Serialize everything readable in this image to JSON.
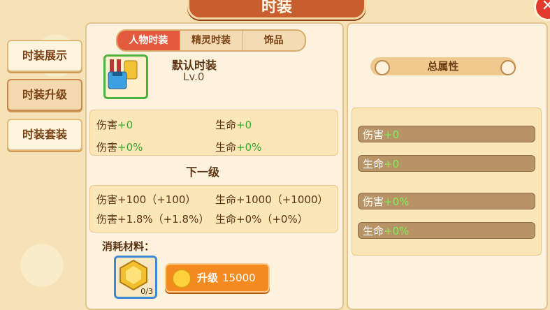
{
  "window": {
    "title": "时装",
    "close_glyph": "✕"
  },
  "sidebar": {
    "items": [
      {
        "label": "时装展示"
      },
      {
        "label": "时装升级",
        "active": true
      },
      {
        "label": "时装套装"
      }
    ]
  },
  "tabs": [
    {
      "label": "人物时装",
      "active": true
    },
    {
      "label": "精灵时装"
    },
    {
      "label": "饰品"
    }
  ],
  "item": {
    "name": "默认时装",
    "level": "Lv.0"
  },
  "current": {
    "damage": {
      "label": "伤害",
      "value": "+0"
    },
    "hp": {
      "label": "生命",
      "value": "+0"
    },
    "damage_pct": {
      "label": "伤害",
      "value": "+0%"
    },
    "hp_pct": {
      "label": "生命",
      "value": "+0%"
    }
  },
  "next": {
    "title": "下一级",
    "row1_left": "伤害+100（+100）",
    "row1_right": "生命+1000（+1000）",
    "row2_left": "伤害+1.8%（+1.8%）",
    "row2_right": "生命+0%（+0%）"
  },
  "materials": {
    "label": "消耗材料：",
    "count": "0/3"
  },
  "upgrade": {
    "label": "升级",
    "cost": "15000"
  },
  "total": {
    "title": "总属性",
    "rows": [
      {
        "label": "伤害",
        "value": "+0"
      },
      {
        "label": "生命",
        "value": "+0"
      },
      {
        "label": "伤害",
        "value": "+0%"
      },
      {
        "label": "生命",
        "value": "+0%"
      }
    ]
  },
  "colors": {
    "accent": "#e35a3c",
    "positive": "#3aa62a",
    "button": "#f58a21"
  }
}
